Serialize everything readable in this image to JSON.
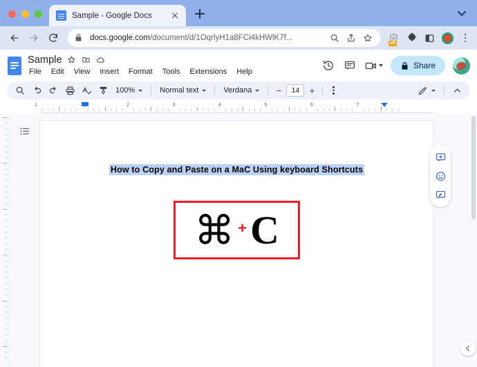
{
  "window": {
    "traffic_lights": [
      "close",
      "minimize",
      "maximize"
    ],
    "tab": {
      "title": "Sample - Google Docs",
      "favicon": "google-docs-favicon",
      "close_icon": "close-icon"
    },
    "new_tab_label": "+",
    "tab_search_icon": "chevron-down-icon"
  },
  "navbar": {
    "back_icon": "back-arrow-icon",
    "forward_icon": "forward-arrow-icon",
    "reload_icon": "reload-icon",
    "lock_icon": "lock-icon",
    "url_host": "docs.google.com",
    "url_path": "/document/d/1OqrlyH1a8FCi4kHWlK7f...",
    "url_full": "docs.google.com/document/d/1OqrlyH1a8FCi4kHWlK7f...",
    "omnibox_icons": [
      "search-icon",
      "share-icon",
      "bookmark-star-icon"
    ],
    "extensions": [
      {
        "name": "adblock-icon",
        "badge": "off"
      },
      {
        "name": "puzzle-extensions-icon",
        "badge": ""
      },
      {
        "name": "side-panel-icon",
        "badge": ""
      },
      {
        "name": "screen-recorder-icon",
        "badge": ""
      }
    ],
    "menu_icon": "three-dot-menu-icon"
  },
  "docs": {
    "logo_icon": "google-docs-logo",
    "title": "Sample",
    "title_icons": [
      "star-icon",
      "move-to-folder-icon",
      "cloud-saved-icon"
    ],
    "menus": [
      "File",
      "Edit",
      "View",
      "Insert",
      "Format",
      "Tools",
      "Extensions",
      "Help"
    ],
    "header_right": {
      "history_icon": "version-history-icon",
      "comment_icon": "comment-icon",
      "meet_icon": "video-camera-icon",
      "share_label": "Share",
      "share_lock_icon": "lock-icon",
      "avatar_icon": "user-avatar"
    },
    "toolbar": {
      "search_icon": "search-icon",
      "undo_icon": "undo-icon",
      "redo_icon": "redo-icon",
      "print_icon": "print-icon",
      "spellcheck_icon": "spellcheck-icon",
      "paint_format_icon": "paint-format-icon",
      "zoom_value": "100%",
      "style_value": "Normal text",
      "font_value": "Verdana",
      "font_size_value": "14",
      "font_size_decrease": "−",
      "font_size_increase": "+",
      "more_icon": "more-options-icon",
      "editing_mode_icon": "pencil-editing-icon",
      "collapse_icon": "chevron-up-icon"
    },
    "ruler": {
      "numbers": [
        "1",
        "1",
        "2",
        "3",
        "4",
        "5",
        "6",
        "7"
      ],
      "left_indent_marker": "left-indent-marker",
      "right_indent_marker": "right-indent-marker"
    },
    "outline_icon": "document-outline-icon",
    "document": {
      "heading": "How to Copy and Paste on a MaC Using keyboard Shortcuts",
      "heading_selected": true,
      "image": {
        "alt": "command-plus-c-shortcut",
        "command_symbol": "⌘",
        "plus_symbol": "+",
        "letter": "C",
        "border_color": "#ee1c25",
        "plus_color": "#ee1c25"
      }
    },
    "float_buttons": [
      "add-comment-icon",
      "emoji-reaction-icon",
      "suggest-edit-icon"
    ],
    "collapse_panel_icon": "chevron-left-icon"
  },
  "colors": {
    "tabstrip": "#8fb0e8",
    "navbar": "#dde5f3",
    "docs_blue": "#4285f4",
    "share_bg": "#c2e7ff",
    "selection": "#bcd2f5",
    "toolbar_bg": "#edf2fa",
    "canvas": "#f8fafd",
    "accent_red": "#ee1c25"
  }
}
